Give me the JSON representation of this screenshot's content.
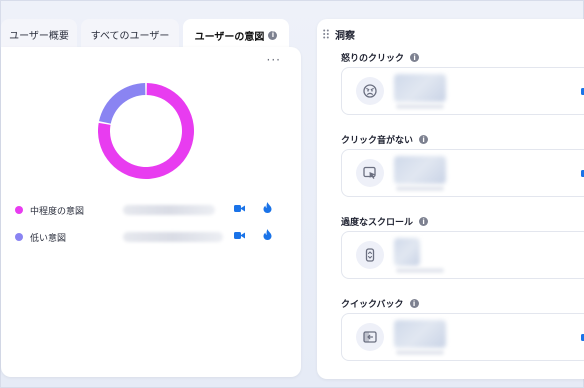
{
  "tabs": [
    {
      "label": "ユーザー概要"
    },
    {
      "label": "すべてのユーザー"
    },
    {
      "label": "ユーザーの意図",
      "active": true,
      "info": "i"
    }
  ],
  "left_card": {
    "more_label": "···",
    "legend": [
      {
        "label": "中程度の意図",
        "color": "#e83cf0"
      },
      {
        "label": "低い意図",
        "color": "#8a84f2"
      }
    ]
  },
  "chart_data": {
    "type": "pie",
    "style": "donut",
    "series": [
      {
        "name": "中程度の意図",
        "value": 78,
        "color": "#e83cf0"
      },
      {
        "name": "低い意図",
        "value": 22,
        "color": "#8a84f2"
      }
    ]
  },
  "insights": {
    "title": "洞察",
    "sections": [
      {
        "label": "怒りのクリック",
        "info": "i",
        "icon": "angry-face-icon"
      },
      {
        "label": "クリック音がない",
        "info": "i",
        "icon": "cursor-click-icon"
      },
      {
        "label": "過度なスクロール",
        "info": "i",
        "icon": "scroll-icon"
      },
      {
        "label": "クイックバック",
        "info": "i",
        "icon": "back-arrow-icon"
      }
    ]
  },
  "colors": {
    "accent_blue": "#1a73e8",
    "magenta": "#e83cf0",
    "purple": "#8a84f2"
  }
}
